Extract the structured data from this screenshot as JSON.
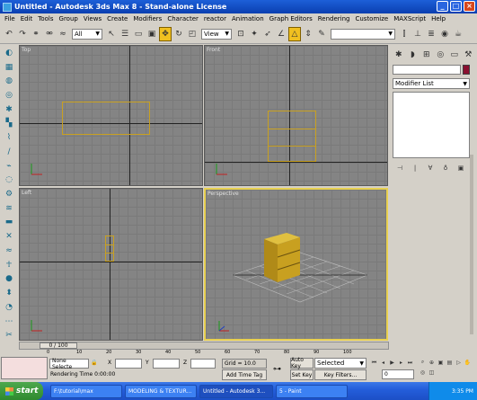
{
  "window": {
    "title": "Untitled - Autodesk 3ds Max 8 - Stand-alone License",
    "controls": [
      "_",
      "□",
      "×"
    ]
  },
  "menu": [
    "File",
    "Edit",
    "Tools",
    "Group",
    "Views",
    "Create",
    "Modifiers",
    "Character",
    "reactor",
    "Animation",
    "Graph Editors",
    "Rendering",
    "Customize",
    "MAXScript",
    "Help"
  ],
  "toolbar": {
    "selection_filter": "All",
    "coord_system": "View"
  },
  "viewports": {
    "top": "Top",
    "front": "Front",
    "left": "Left",
    "perspective": "Perspective"
  },
  "command_panel": {
    "modifier_list": "Modifier List"
  },
  "timeline": {
    "frame_counter": "0 / 100",
    "ticks": [
      "0",
      "10",
      "20",
      "30",
      "40",
      "50",
      "60",
      "70",
      "80",
      "90",
      "100"
    ]
  },
  "status": {
    "selection": "None Selecte",
    "x_label": "X",
    "y_label": "Y",
    "z_label": "Z",
    "grid": "Grid = 10.0",
    "rendering_time": "Rendering Time  0:00:00",
    "add_time_tag": "Add Time Tag",
    "auto_key": "Auto Key",
    "set_key": "Set Key",
    "key_mode": "Selected",
    "key_filters": "Key Filters...",
    "frame": "0"
  },
  "taskbar": {
    "start": "start",
    "tasks": [
      "F:\\tutorial\\max",
      "MODELING & TEXTUR...",
      "Untitled - Autodesk 3...",
      "5 - Paint"
    ],
    "clock": "3:35 PM"
  },
  "colors": {
    "viewport_bg": "#848484",
    "active_border": "#e8d050",
    "object_color": "#c8a020",
    "title_blue": "#0a3fb0"
  }
}
